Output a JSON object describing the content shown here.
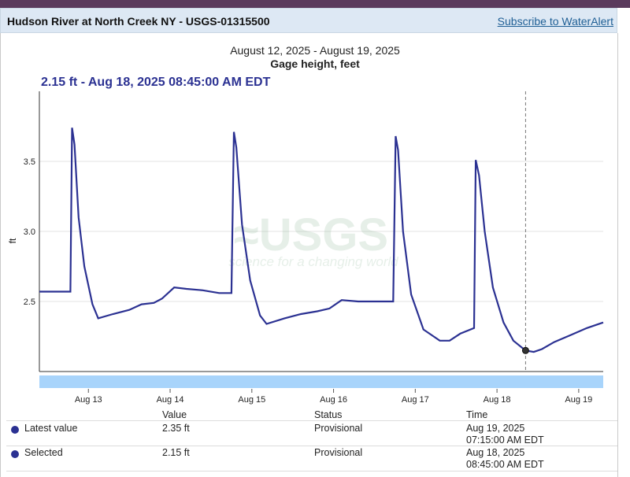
{
  "header": {
    "site_title": "Hudson River at North Creek NY - USGS-01315500",
    "subscribe_label": "Subscribe to WaterAlert"
  },
  "chart_data": {
    "type": "line",
    "date_range": "August 12, 2025 - August 19, 2025",
    "title": "Gage height, feet",
    "ylabel": "ft",
    "ylim": [
      2.0,
      4.0
    ],
    "y_ticks": [
      {
        "value": 2.5,
        "label": "2.5"
      },
      {
        "value": 3.0,
        "label": "3.0"
      },
      {
        "value": 3.5,
        "label": "3.5"
      }
    ],
    "x_ticks": [
      {
        "day": 13,
        "label": "Aug 13"
      },
      {
        "day": 14,
        "label": "Aug 14"
      },
      {
        "day": 15,
        "label": "Aug 15"
      },
      {
        "day": 16,
        "label": "Aug 16"
      },
      {
        "day": 17,
        "label": "Aug 17"
      },
      {
        "day": 18,
        "label": "Aug 18"
      },
      {
        "day": 19,
        "label": "Aug 19"
      }
    ],
    "xlim_days": [
      12.4,
      19.3
    ],
    "grid": true,
    "color": "#2b3192",
    "series": [
      {
        "points": [
          [
            12.4,
            2.57
          ],
          [
            12.78,
            2.57
          ],
          [
            12.8,
            3.74
          ],
          [
            12.83,
            3.62
          ],
          [
            12.88,
            3.1
          ],
          [
            12.95,
            2.75
          ],
          [
            13.05,
            2.48
          ],
          [
            13.12,
            2.38
          ],
          [
            13.3,
            2.41
          ],
          [
            13.5,
            2.44
          ],
          [
            13.65,
            2.48
          ],
          [
            13.8,
            2.49
          ],
          [
            13.9,
            2.52
          ],
          [
            14.05,
            2.6
          ],
          [
            14.2,
            2.59
          ],
          [
            14.4,
            2.58
          ],
          [
            14.6,
            2.56
          ],
          [
            14.75,
            2.56
          ],
          [
            14.78,
            3.71
          ],
          [
            14.81,
            3.6
          ],
          [
            14.88,
            3.05
          ],
          [
            14.98,
            2.65
          ],
          [
            15.1,
            2.4
          ],
          [
            15.18,
            2.34
          ],
          [
            15.4,
            2.38
          ],
          [
            15.6,
            2.41
          ],
          [
            15.8,
            2.43
          ],
          [
            15.95,
            2.45
          ],
          [
            16.1,
            2.51
          ],
          [
            16.3,
            2.5
          ],
          [
            16.55,
            2.5
          ],
          [
            16.73,
            2.5
          ],
          [
            16.76,
            3.68
          ],
          [
            16.79,
            3.58
          ],
          [
            16.85,
            3.0
          ],
          [
            16.95,
            2.55
          ],
          [
            17.1,
            2.3
          ],
          [
            17.3,
            2.22
          ],
          [
            17.42,
            2.22
          ],
          [
            17.55,
            2.27
          ],
          [
            17.72,
            2.31
          ],
          [
            17.74,
            3.51
          ],
          [
            17.78,
            3.4
          ],
          [
            17.85,
            3.0
          ],
          [
            17.95,
            2.6
          ],
          [
            18.08,
            2.35
          ],
          [
            18.2,
            2.22
          ],
          [
            18.35,
            2.15
          ],
          [
            18.45,
            2.14
          ],
          [
            18.55,
            2.16
          ],
          [
            18.7,
            2.21
          ],
          [
            18.9,
            2.26
          ],
          [
            19.1,
            2.31
          ],
          [
            19.3,
            2.35
          ]
        ]
      }
    ],
    "selected_point": {
      "day": 18.35,
      "value": 2.15
    }
  },
  "selected_readout": "2.15 ft - Aug 18, 2025 08:45:00 AM EDT",
  "table": {
    "headers": {
      "value": "Value",
      "status": "Status",
      "time": "Time"
    },
    "rows": [
      {
        "label": "Latest value",
        "value": "2.35 ft",
        "status": "Provisional",
        "time_date": "Aug 19, 2025",
        "time_clock": "07:15:00 AM EDT"
      },
      {
        "label": "Selected",
        "value": "2.15 ft",
        "status": "Provisional",
        "time_date": "Aug 18, 2025",
        "time_clock": "08:45:00 AM EDT"
      }
    ]
  }
}
